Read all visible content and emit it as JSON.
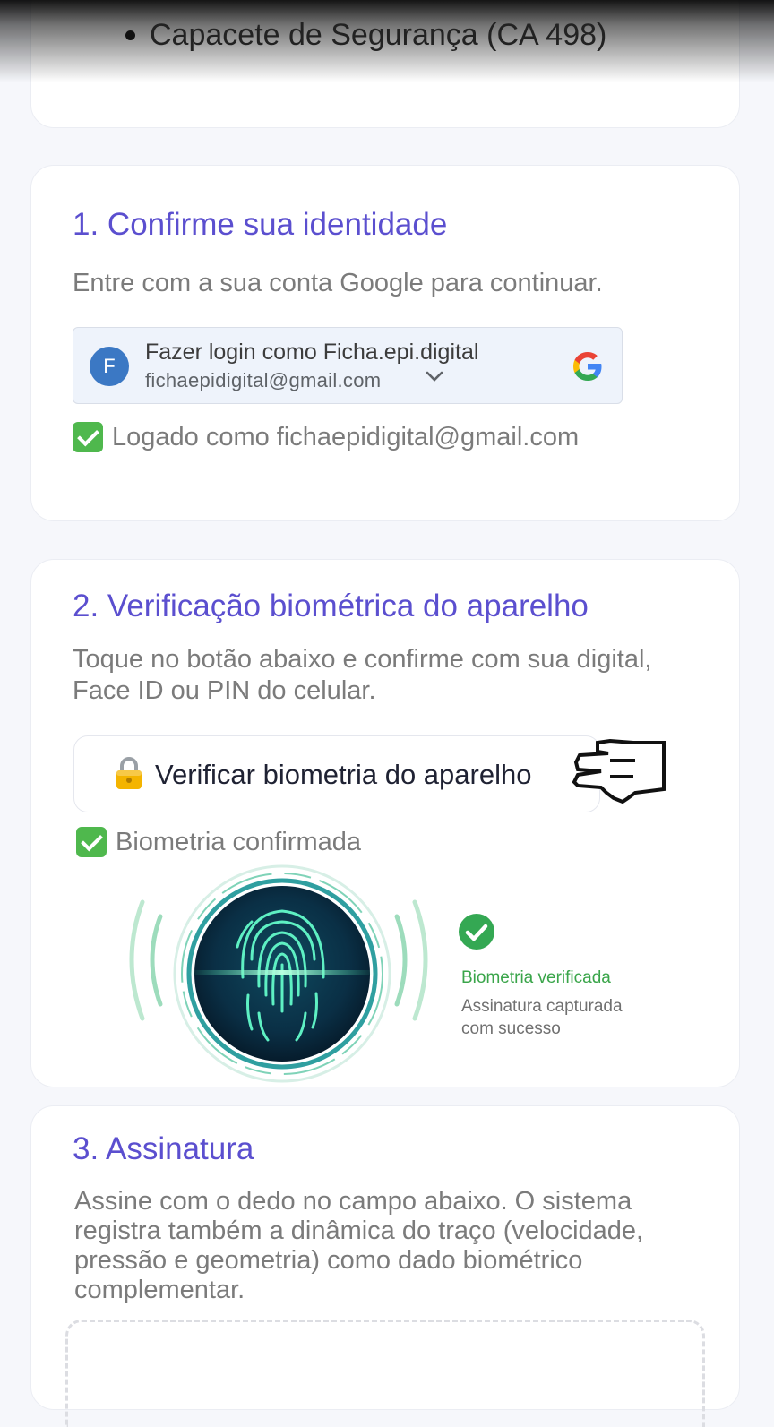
{
  "top_list": {
    "item": "Capacete de Segurança (CA 498)"
  },
  "section1": {
    "title": "1. Confirme sua identidade",
    "description": "Entre com a sua conta Google para continuar.",
    "google": {
      "avatar_letter": "F",
      "signin_label": "Fazer login como Ficha.epi.digital",
      "email": "fichaepidigital@gmail.com"
    },
    "status": "Logado como fichaepidigital@gmail.com"
  },
  "section2": {
    "title": "2. Verificação biométrica do aparelho",
    "description_line1": "Toque no botão abaixo e confirme com sua digital,",
    "description_line2": "Face ID ou PIN do celular.",
    "button_label": "Verificar biometria do aparelho",
    "status": "Biometria confirmada",
    "result_title": "Biometria verificada",
    "result_sub_line1": "Assinatura capturada",
    "result_sub_line2": "com sucesso"
  },
  "section3": {
    "title": "3. Assinatura",
    "description_lines": [
      "Assine com o dedo no campo abaixo. O sistema",
      "registra também a dinâmica do traço (velocidade,",
      "pressão e geometria) como dado biométrico",
      "complementar."
    ]
  },
  "colors": {
    "accent": "#5b4fcf",
    "success": "#3aa54a",
    "google_avatar": "#3b78c4"
  }
}
